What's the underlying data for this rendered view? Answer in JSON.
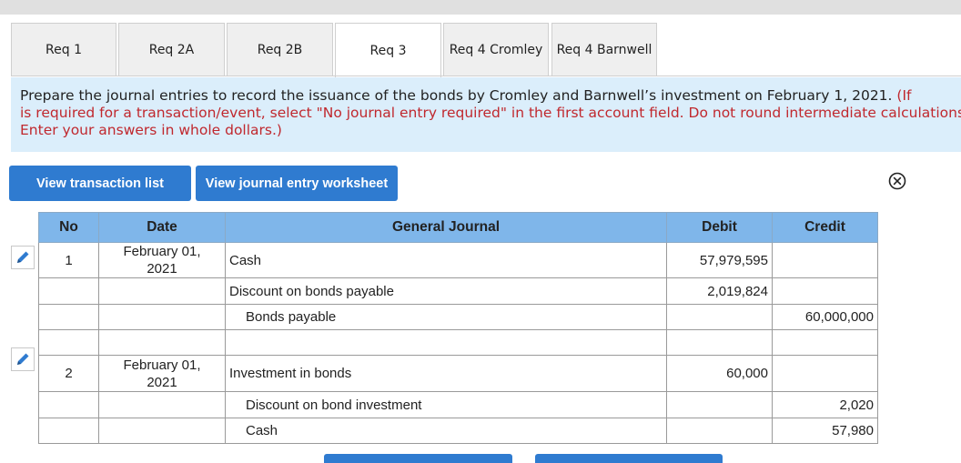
{
  "tabs": [
    {
      "label": "Req 1"
    },
    {
      "label": "Req 2A"
    },
    {
      "label": "Req 2B"
    },
    {
      "label": "Req 3",
      "active": true
    },
    {
      "label": "Req 4 Cromley"
    },
    {
      "label": "Req 4 Barnwell"
    }
  ],
  "instructions": {
    "line1_prefix": "Prepare the journal entries to record the issuance of the bonds by Cromley and Barnwell’s investment on February 1, 2021. ",
    "line1_red": "(If",
    "line2": "is required for a transaction/event, select \"No journal entry required\" in the first account field. Do not round intermediate calculations.",
    "line3": "Enter your answers in whole dollars.)"
  },
  "buttons": {
    "view_transaction_list": "View transaction list",
    "view_journal_worksheet": "View journal entry worksheet"
  },
  "icons": {
    "close": "close-circle-icon",
    "edit": "pencil-icon"
  },
  "colors": {
    "accent": "#2f7bd0",
    "header": "#7fb6ea",
    "instruction_bg": "#dbeefb",
    "instruction_red": "#c0282e"
  },
  "table": {
    "headers": {
      "no": "No",
      "date": "Date",
      "journal": "General Journal",
      "debit": "Debit",
      "credit": "Credit"
    },
    "rows": [
      {
        "no": "1",
        "date_line1": "February 01,",
        "date_line2": "2021",
        "account": "Cash",
        "debit": "57,979,595",
        "credit": ""
      },
      {
        "no": "",
        "date_line1": "",
        "date_line2": "",
        "account": "Discount on bonds payable",
        "debit": "2,019,824",
        "credit": ""
      },
      {
        "no": "",
        "date_line1": "",
        "date_line2": "",
        "account": "Bonds payable",
        "debit": "",
        "credit": "60,000,000"
      },
      {
        "no": "",
        "date_line1": "",
        "date_line2": "",
        "account": "",
        "debit": "",
        "credit": ""
      },
      {
        "no": "2",
        "date_line1": "February 01,",
        "date_line2": "2021",
        "account": "Investment in bonds",
        "debit": "60,000",
        "credit": ""
      },
      {
        "no": "",
        "date_line1": "",
        "date_line2": "",
        "account": "Discount on bond investment",
        "debit": "",
        "credit": "2,020"
      },
      {
        "no": "",
        "date_line1": "",
        "date_line2": "",
        "account": "Cash",
        "debit": "",
        "credit": "57,980"
      }
    ]
  }
}
